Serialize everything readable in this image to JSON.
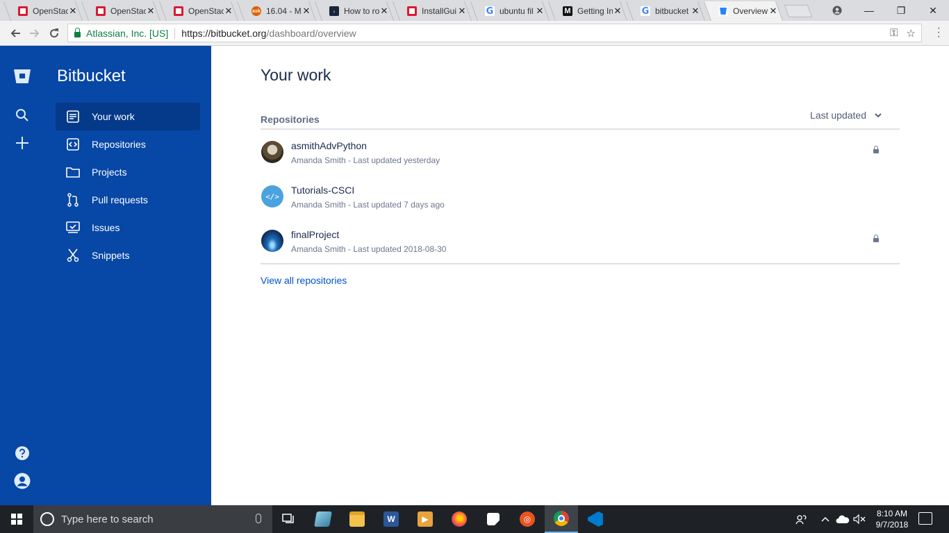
{
  "browser": {
    "tabs": [
      {
        "title": "OpenStack",
        "favicon": "openstack-icon",
        "active": false
      },
      {
        "title": "OpenStack",
        "favicon": "openstack-icon",
        "active": false
      },
      {
        "title": "OpenStack",
        "favicon": "openstack-icon",
        "active": false
      },
      {
        "title": "16.04 - M",
        "favicon": "askubuntu-icon",
        "active": false
      },
      {
        "title": "How to ro",
        "favicon": "powershell-icon",
        "active": false
      },
      {
        "title": "InstallGui",
        "favicon": "openstack-icon",
        "active": false
      },
      {
        "title": "ubuntu fil",
        "favicon": "google-icon",
        "active": false
      },
      {
        "title": "Getting In",
        "favicon": "medium-icon",
        "active": false
      },
      {
        "title": "bitbucket",
        "favicon": "google-icon",
        "active": false
      },
      {
        "title": "Overview",
        "favicon": "bitbucket-icon",
        "active": true
      }
    ],
    "secure_label": "Atlassian, Inc. [US]",
    "url_host": "https://bitbucket.org",
    "url_path": "/dashboard/overview",
    "colors": {
      "secure": "#0b8043",
      "tab_strip": "#dadcdf"
    }
  },
  "sidebar": {
    "brand": "Bitbucket",
    "nav": [
      {
        "label": "Your work",
        "icon": "your-work-icon",
        "active": true
      },
      {
        "label": "Repositories",
        "icon": "repositories-icon",
        "active": false
      },
      {
        "label": "Projects",
        "icon": "projects-icon",
        "active": false
      },
      {
        "label": "Pull requests",
        "icon": "pull-requests-icon",
        "active": false
      },
      {
        "label": "Issues",
        "icon": "issues-icon",
        "active": false
      },
      {
        "label": "Snippets",
        "icon": "snippets-icon",
        "active": false
      }
    ],
    "colors": {
      "background": "#0747a6",
      "active": "#053a8a"
    }
  },
  "main": {
    "title": "Your work",
    "section_label": "Repositories",
    "sort_label": "Last updated",
    "repositories": [
      {
        "name": "asmithAdvPython",
        "meta": "Amanda Smith - Last updated yesterday",
        "private": true
      },
      {
        "name": "Tutorials-CSCI",
        "meta": "Amanda Smith - Last updated 7 days ago",
        "private": false
      },
      {
        "name": "finalProject",
        "meta": "Amanda Smith - Last updated 2018-08-30",
        "private": true
      }
    ],
    "view_all": "View all repositories",
    "colors": {
      "link": "#0052cc",
      "text": "#172b4d",
      "muted": "#6b778c"
    }
  },
  "taskbar": {
    "search_placeholder": "Type here to search",
    "apps": [
      "task-view-icon",
      "unknown-app-icon",
      "file-explorer-icon",
      "word-icon",
      "media-player-icon",
      "firefox-icon",
      "sticky-notes-icon",
      "ubuntu-icon",
      "chrome-icon",
      "vscode-icon"
    ],
    "time": "8:10 AM",
    "date": "9/7/2018"
  }
}
